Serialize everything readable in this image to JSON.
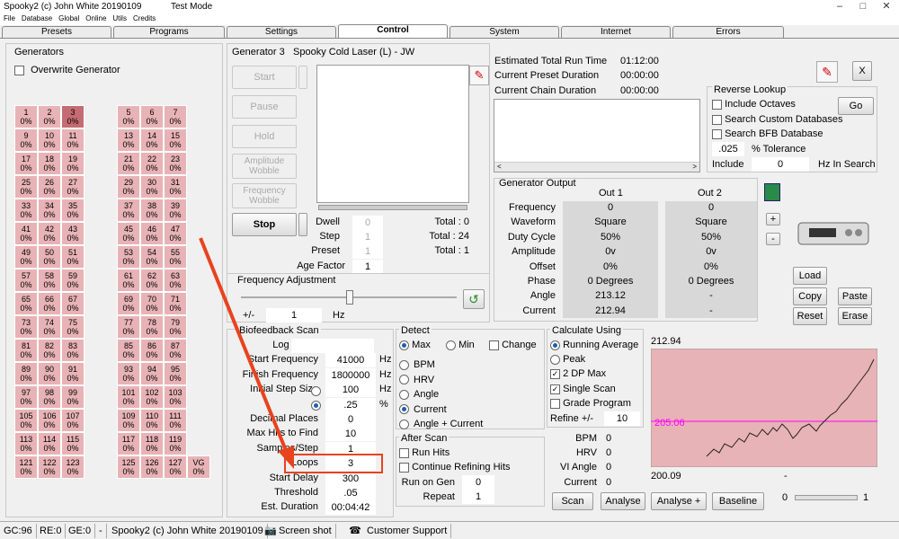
{
  "window": {
    "title": "Spooky2 (c) John White 20190109",
    "mode": "Test Mode",
    "min": "–",
    "max": "□",
    "close": "✕"
  },
  "menu": [
    "File",
    "Database",
    "Global",
    "Online",
    "Utils",
    "Credits"
  ],
  "tabs": [
    "Presets",
    "Programs",
    "Settings",
    "Control",
    "System",
    "Internet",
    "Errors"
  ],
  "generators": {
    "title": "Generators",
    "overwrite": "Overwrite Generator",
    "left_cells": [
      "1\n0%",
      "2\n0%",
      "3\n0%",
      "",
      "9\n0%",
      "10\n0%",
      "11\n0%",
      "",
      "17\n0%",
      "18\n0%",
      "19\n0%",
      "",
      "25\n0%",
      "26\n0%",
      "27\n0%",
      "",
      "33\n0%",
      "34\n0%",
      "35\n0%",
      "",
      "41\n0%",
      "42\n0%",
      "43\n0%",
      "",
      "49\n0%",
      "50\n0%",
      "51\n0%",
      "",
      "57\n0%",
      "58\n0%",
      "59\n0%",
      "",
      "65\n0%",
      "66\n0%",
      "67\n0%",
      "",
      "73\n0%",
      "74\n0%",
      "75\n0%",
      "",
      "81\n0%",
      "82\n0%",
      "83\n0%",
      "",
      "89\n0%",
      "90\n0%",
      "91\n0%",
      "",
      "97\n0%",
      "98\n0%",
      "99\n0%",
      "",
      "105\n0%",
      "106\n0%",
      "107\n0%",
      "",
      "113\n0%",
      "114\n0%",
      "115\n0%",
      "",
      "121\n0%",
      "122\n0%",
      "123\n0%",
      ""
    ],
    "right_cells": [
      "5\n0%",
      "6\n0%",
      "7\n0%",
      "",
      "13\n0%",
      "14\n0%",
      "15\n0%",
      "",
      "21\n0%",
      "22\n0%",
      "23\n0%",
      "",
      "29\n0%",
      "30\n0%",
      "31\n0%",
      "",
      "37\n0%",
      "38\n0%",
      "39\n0%",
      "",
      "45\n0%",
      "46\n0%",
      "47\n0%",
      "",
      "53\n0%",
      "54\n0%",
      "55\n0%",
      "",
      "61\n0%",
      "62\n0%",
      "63\n0%",
      "",
      "69\n0%",
      "70\n0%",
      "71\n0%",
      "",
      "77\n0%",
      "78\n0%",
      "79\n0%",
      "",
      "85\n0%",
      "86\n0%",
      "87\n0%",
      "",
      "93\n0%",
      "94\n0%",
      "95\n0%",
      "",
      "101\n0%",
      "102\n0%",
      "103\n0%",
      "",
      "109\n0%",
      "110\n0%",
      "111\n0%",
      "",
      "117\n0%",
      "118\n0%",
      "119\n0%",
      "",
      "125\n0%",
      "126\n0%",
      "127\n0%",
      "VG\n0%"
    ],
    "selected": "3"
  },
  "control": {
    "generator_label": "Generator 3",
    "program_name": "Spooky Cold Laser (L) - JW",
    "buttons": {
      "start": "Start",
      "pause": "Pause",
      "hold": "Hold",
      "amp_wobble": "Amplitude\nWobble",
      "freq_wobble": "Frequency\nWobble",
      "stop": "Stop"
    },
    "dwell_label": "Dwell",
    "dwell_val": "0",
    "total_dwell": "Total : 0",
    "step_label": "Step",
    "step_val": "1",
    "total_step": "Total : 24",
    "preset_label": "Preset",
    "preset_val": "1",
    "total_preset": "Total : 1",
    "age_label": "Age Factor",
    "age_val": "1"
  },
  "freq_adj": {
    "title": "Frequency Adjustment",
    "pm_label": "+/-",
    "pm_val": "1",
    "unit": "Hz"
  },
  "times": {
    "est_label": "Estimated Total Run Time",
    "est_val": "01:12:00",
    "preset_label": "Current Preset Duration",
    "preset_val": "00:00:00",
    "chain_label": "Current Chain Duration",
    "chain_val": "00:00:00"
  },
  "reverse": {
    "title": "Reverse Lookup",
    "octaves": "Include Octaves",
    "custom": "Search Custom Databases",
    "bfb": "Search BFB Database",
    "go": "Go",
    "tol_val": ".025",
    "tol_label": "% Tolerance",
    "include_label": "Include",
    "include_val": "0",
    "hz_label": "Hz In Search"
  },
  "output": {
    "title": "Generator Output",
    "out1": "Out 1",
    "out2": "Out 2",
    "rows": [
      {
        "label": "Frequency",
        "o1": "0",
        "o2": "0"
      },
      {
        "label": "Waveform",
        "o1": "Square",
        "o2": "Square"
      },
      {
        "label": "Duty Cycle",
        "o1": "50%",
        "o2": "50%"
      },
      {
        "label": "Amplitude",
        "o1": "0v",
        "o2": "0v"
      },
      {
        "label": "Offset",
        "o1": "0%",
        "o2": "0%"
      },
      {
        "label": "Phase",
        "o1": "0 Degrees",
        "o2": "0 Degrees"
      },
      {
        "label": "Angle",
        "o1": "213.12",
        "o2": "-"
      },
      {
        "label": "Current",
        "o1": "212.94",
        "o2": "-"
      }
    ],
    "plus": "+",
    "minus": "-"
  },
  "side_buttons": {
    "load": "Load",
    "copy": "Copy",
    "paste": "Paste",
    "reset": "Reset",
    "erase": "Erase",
    "close": "X"
  },
  "bio": {
    "title": "Biofeedback Scan",
    "rows": [
      {
        "label": "Log Name",
        "val": ""
      },
      {
        "label": "Start Frequency",
        "val": "41000",
        "unit": "Hz"
      },
      {
        "label": "Finish Frequency",
        "val": "1800000",
        "unit": "Hz"
      },
      {
        "label": "Initial Step Size",
        "val": "100",
        "unit": "Hz"
      },
      {
        "label": "",
        "val": ".25",
        "unit": "%"
      },
      {
        "label": "Decimal Places",
        "val": "0"
      },
      {
        "label": "Max Hits to Find",
        "val": "10"
      },
      {
        "label": "Samples/Step",
        "val": "1"
      },
      {
        "label": "Loops",
        "val": "3"
      },
      {
        "label": "Start Delay",
        "val": "300"
      },
      {
        "label": "Threshold",
        "val": ".05"
      },
      {
        "label": "Est. Duration",
        "val": "00:04:42"
      }
    ]
  },
  "detect": {
    "title": "Detect",
    "max": "Max",
    "min": "Min",
    "change": "Change",
    "options": [
      "BPM",
      "HRV",
      "Angle",
      "Current",
      "Angle + Current"
    ],
    "selected": "Current"
  },
  "after": {
    "title": "After Scan",
    "run_hits": "Run Hits",
    "continue": "Continue Refining Hits",
    "run_on_gen": "Run on Gen",
    "run_on_gen_val": "0",
    "repeat": "Repeat",
    "repeat_val": "1"
  },
  "calc": {
    "title": "Calculate Using",
    "options": [
      "Running Average",
      "Peak",
      "2 DP Max",
      "Single Scan",
      "Grade Program"
    ],
    "refine_label": "Refine +/-",
    "refine_val": "10",
    "bpm": "BPM",
    "bpm_val": "0",
    "hrv": "HRV",
    "hrv_val": "0",
    "vi": "VI Angle",
    "vi_val": "0",
    "cur": "Current",
    "cur_val": "0"
  },
  "graph": {
    "top": "212.94",
    "mid": "205.06",
    "bottom": "200.09",
    "dash": "-",
    "slider_min": "0",
    "slider_max": "1"
  },
  "scan_buttons": {
    "scan": "Scan",
    "analyse": "Analyse",
    "analyse_plus": "Analyse +",
    "baseline": "Baseline"
  },
  "status": {
    "gc": "GC:96",
    "re": "RE:0",
    "ge": "GE:0",
    "dash": "-",
    "app": "Spooky2 (c) John White 20190109",
    "screenshot": "Screen shot",
    "support": "Customer Support"
  },
  "colors": {
    "cell": "#e8b3b6",
    "cell_selected": "#c56c72",
    "graph_bg": "#e8b3b6",
    "graph_line": "#ff00ff",
    "highlight": "#e8431e"
  }
}
